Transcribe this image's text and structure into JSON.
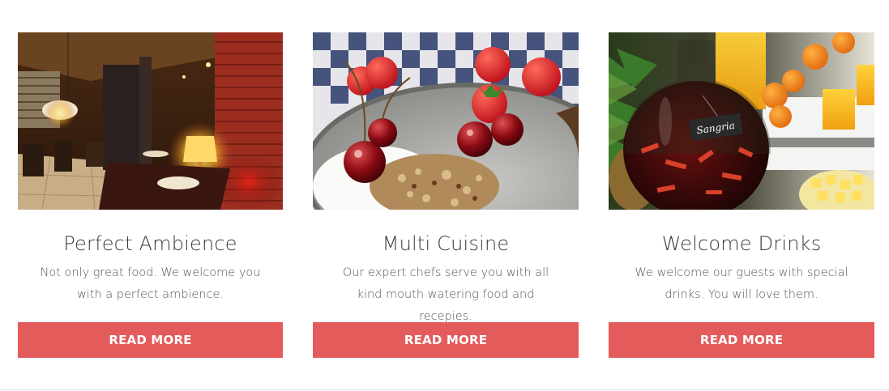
{
  "cards": [
    {
      "title": "Perfect Ambience",
      "description": "Not only great food. We welcome you with a perfect ambience.",
      "button_label": "READ MORE",
      "image_subject": "restaurant-interior"
    },
    {
      "title": "Multi Cuisine",
      "description": "Our expert chefs serve you with all kind mouth watering food and recepies.",
      "button_label": "READ MORE",
      "image_subject": "cherries-granola-plate"
    },
    {
      "title": "Welcome Drinks",
      "description": "We welcome our guests with special drinks. You will love them.",
      "button_label": "READ MORE",
      "image_subject": "sangria-bottle",
      "image_sign_text": "Sangria"
    }
  ],
  "colors": {
    "button": "#e45b5b",
    "button_text": "#ffffff",
    "title": "#3a3a3a",
    "body_text": "#555555"
  }
}
